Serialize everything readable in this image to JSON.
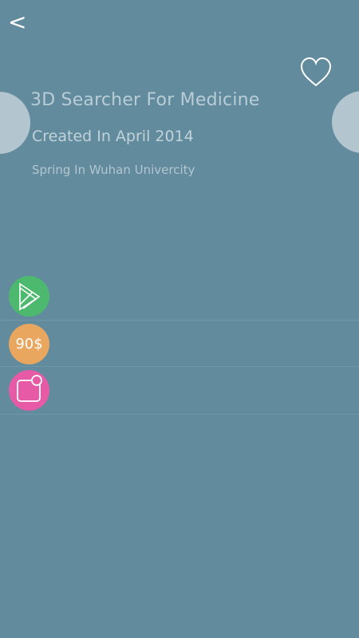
{
  "header": {
    "back_label": "<",
    "favorite_icon": "heart-outline-icon"
  },
  "detail": {
    "title": "3D Searcher For Medicine",
    "created": "Created In April 2014",
    "location": "Spring In Wuhan Univercity"
  },
  "actions": [
    {
      "name": "play-icon",
      "color": "#4cb96e"
    },
    {
      "name": "price-badge",
      "label": "90$",
      "color": "#e9a65f"
    },
    {
      "name": "screen-icon",
      "color": "#e75aa5"
    }
  ],
  "colors": {
    "background": "#628b9e",
    "text": "#b9cdd6",
    "accent_side": "#b3c6cf"
  }
}
